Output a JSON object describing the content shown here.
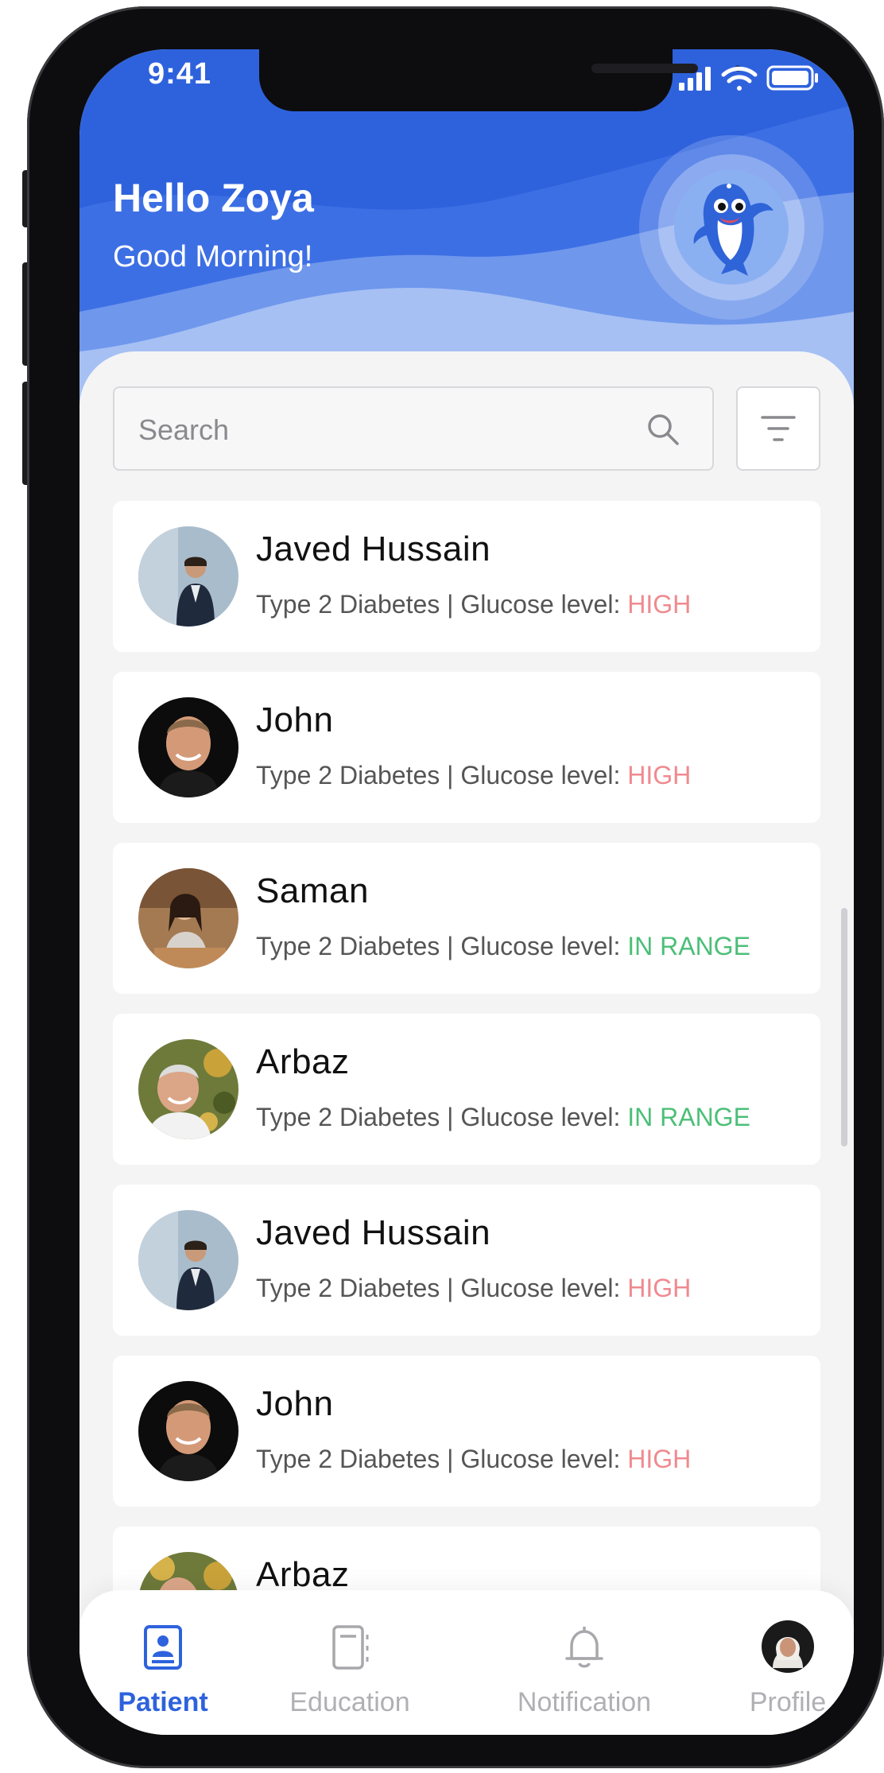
{
  "status_bar": {
    "time": "9:41"
  },
  "header": {
    "greeting": "Hello Zoya",
    "subgreeting": "Good Morning!"
  },
  "search": {
    "placeholder": "Search"
  },
  "patients": [
    {
      "name": "Javed Hussain",
      "condition": "Type 2 Diabetes | Glucose level: ",
      "level": "HIGH",
      "level_status": "high"
    },
    {
      "name": "John",
      "condition": "Type 2 Diabetes | Glucose level: ",
      "level": "HIGH",
      "level_status": "high"
    },
    {
      "name": "Saman",
      "condition": "Type 2 Diabetes | Glucose level: ",
      "level": "IN RANGE",
      "level_status": "in-range"
    },
    {
      "name": "Arbaz",
      "condition": "Type 2 Diabetes | Glucose level: ",
      "level": "IN RANGE",
      "level_status": "in-range"
    },
    {
      "name": "Javed Hussain",
      "condition": "Type 2 Diabetes | Glucose level: ",
      "level": "HIGH",
      "level_status": "high"
    },
    {
      "name": "John",
      "condition": "Type 2 Diabetes | Glucose level: ",
      "level": "HIGH",
      "level_status": "high"
    },
    {
      "name": "Arbaz",
      "condition": "",
      "level": "",
      "level_status": "in-range"
    }
  ],
  "tabs": [
    {
      "label": "Patient",
      "icon": "patient-icon",
      "active": true
    },
    {
      "label": "Education",
      "icon": "book-icon",
      "active": false
    },
    {
      "label": "Notification",
      "icon": "bell-icon",
      "active": false
    },
    {
      "label": "Profile",
      "icon": "profile-avatar",
      "active": false
    }
  ],
  "colors": {
    "primary": "#2e62dd",
    "high": "#ef8a8f",
    "in_range": "#4cbf78"
  }
}
